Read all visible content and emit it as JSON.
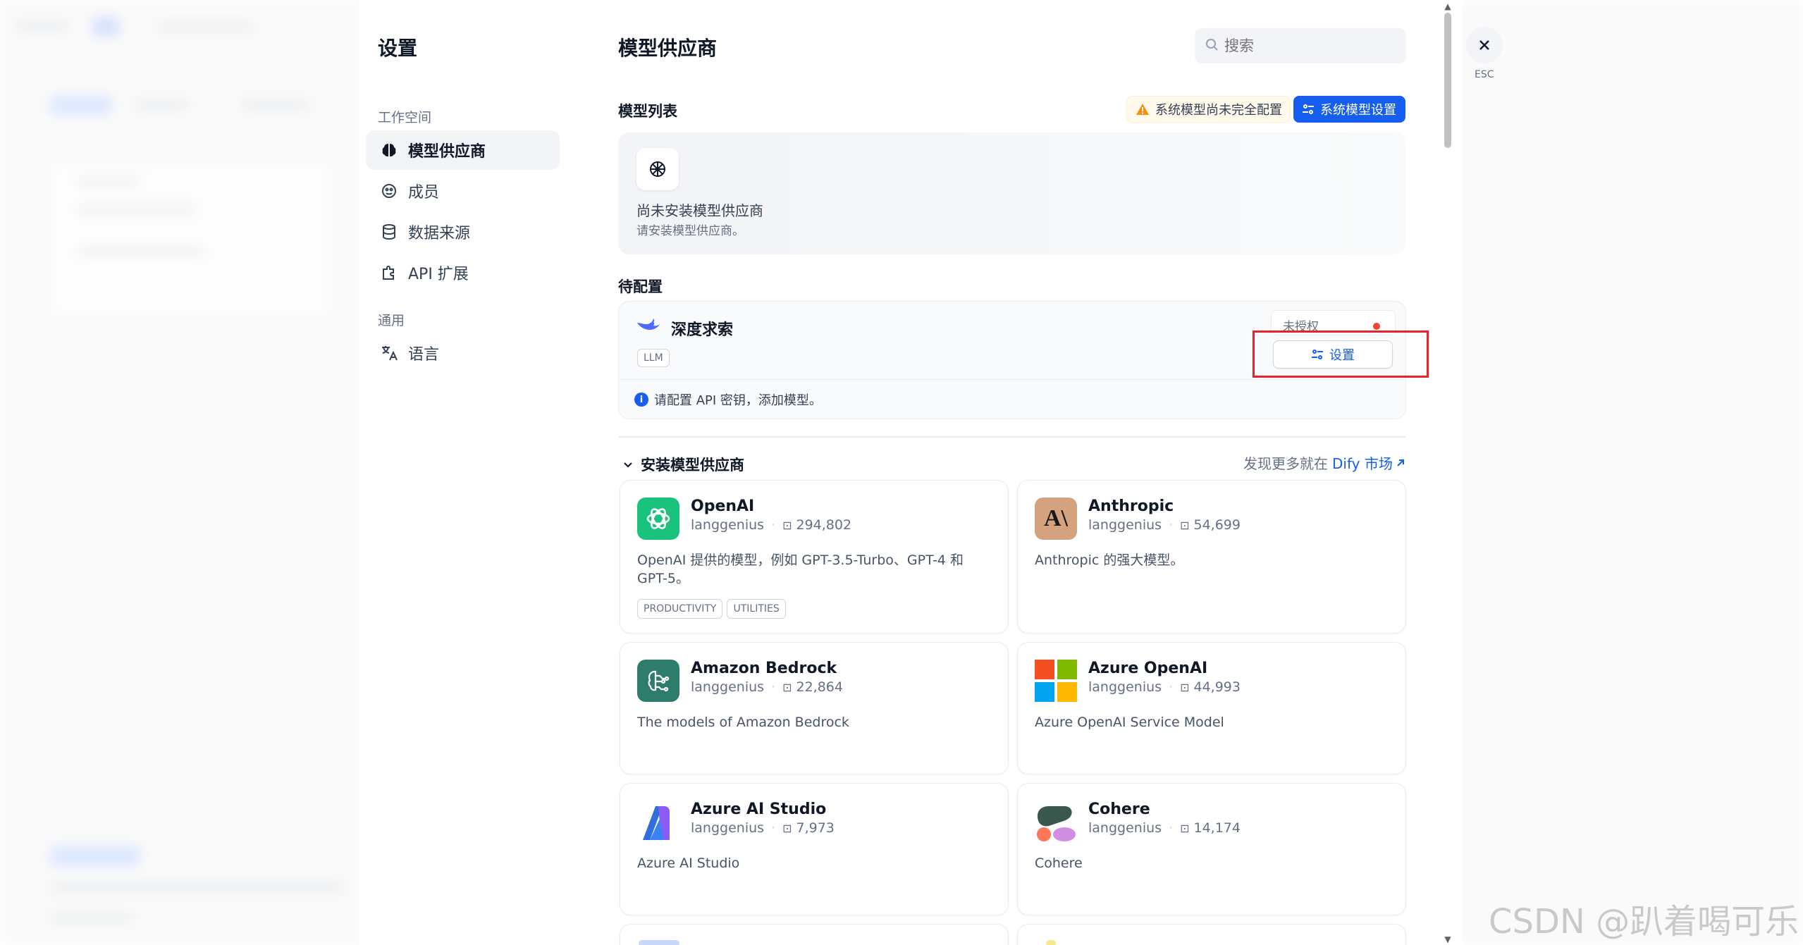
{
  "settings": {
    "title": "设置",
    "workspace_label": "工作空间",
    "general_label": "通用",
    "nav": [
      {
        "label": "模型供应商",
        "icon": "brain-icon",
        "active": true
      },
      {
        "label": "成员",
        "icon": "members-icon",
        "active": false
      },
      {
        "label": "数据来源",
        "icon": "database-icon",
        "active": false
      },
      {
        "label": "API 扩展",
        "icon": "puzzle-icon",
        "active": false
      }
    ],
    "language": {
      "label": "语言",
      "icon": "translate-icon"
    }
  },
  "main": {
    "title": "模型供应商",
    "search": {
      "placeholder": "搜索",
      "value": ""
    },
    "model_list": {
      "title": "模型列表",
      "warning": "系统模型尚未完全配置",
      "system_button": "系统模型设置",
      "empty_title": "尚未安装模型供应商",
      "empty_sub": "请安装模型供应商。"
    },
    "pending": {
      "title": "待配置",
      "provider": {
        "name": "深度求索",
        "tag": "LLM",
        "status": "未授权",
        "setup_button": "设置",
        "info": "请配置 API 密钥，添加模型。"
      }
    },
    "install": {
      "title": "安装模型供应商",
      "discover_prefix": "发现更多就在",
      "discover_link": "Dify 市场",
      "providers": [
        {
          "name": "OpenAI",
          "author": "langgenius",
          "downloads": "294,802",
          "desc": "OpenAI 提供的模型，例如 GPT-3.5-Turbo、GPT-4 和 GPT-5。",
          "tags": [
            "PRODUCTIVITY",
            "UTILITIES"
          ],
          "logo": "openai-logo"
        },
        {
          "name": "Anthropic",
          "author": "langgenius",
          "downloads": "54,699",
          "desc": "Anthropic 的强大模型。",
          "tags": [],
          "logo": "anthropic-logo"
        },
        {
          "name": "Amazon Bedrock",
          "author": "langgenius",
          "downloads": "22,864",
          "desc": "The models of Amazon Bedrock",
          "tags": [],
          "logo": "bedrock-logo"
        },
        {
          "name": "Azure OpenAI",
          "author": "langgenius",
          "downloads": "44,993",
          "desc": "Azure OpenAI Service Model",
          "tags": [],
          "logo": "azure-openai-logo"
        },
        {
          "name": "Azure AI Studio",
          "author": "langgenius",
          "downloads": "7,973",
          "desc": "Azure AI Studio",
          "tags": [],
          "logo": "azure-ai-studio-logo"
        },
        {
          "name": "Cohere",
          "author": "langgenius",
          "downloads": "14,174",
          "desc": "Cohere",
          "tags": [],
          "logo": "cohere-logo"
        }
      ]
    }
  },
  "close": {
    "esc_label": "ESC"
  },
  "watermark": "CSDN @趴着喝可乐",
  "colors": {
    "accent": "#155eef",
    "highlight": "#e5232c",
    "warning": "#f79009"
  }
}
